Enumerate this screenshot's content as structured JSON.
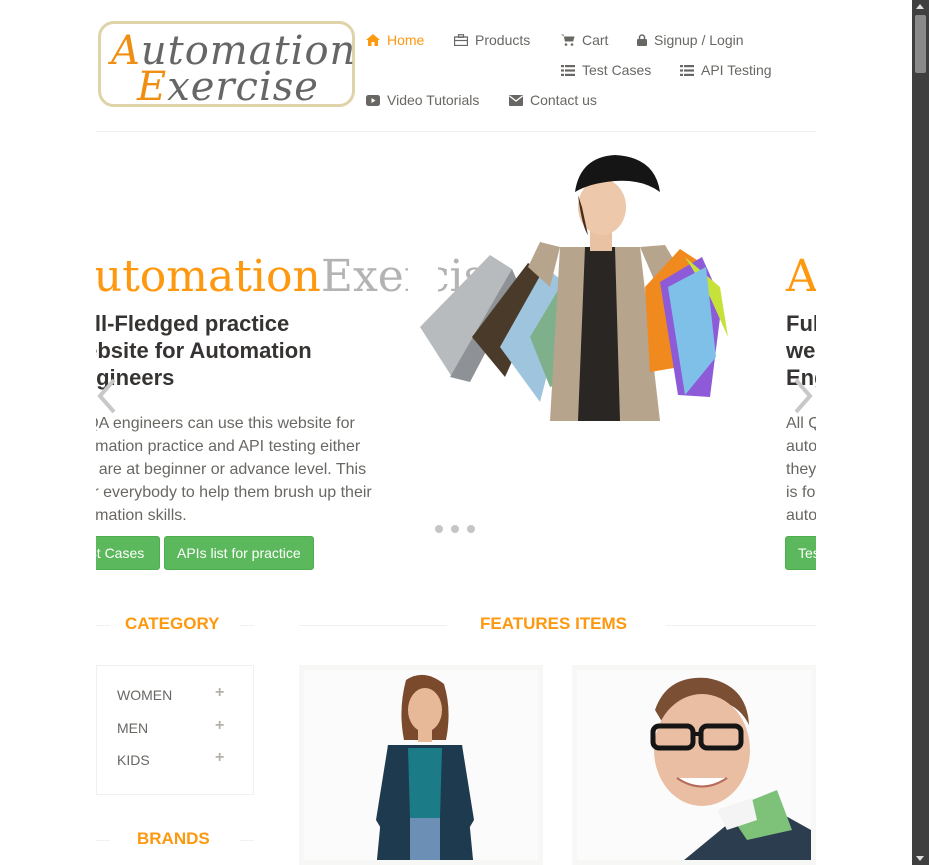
{
  "logo": {
    "line1_cap": "A",
    "line1_rest": "utomation",
    "line2_cap": "E",
    "line2_rest": "xercise"
  },
  "nav": {
    "home": "Home",
    "products": "Products",
    "cart": "Cart",
    "signup": "Signup / Login",
    "test_cases": "Test Cases",
    "api_testing": "API Testing",
    "video": "Video Tutorials",
    "contact": "Contact us"
  },
  "slider": {
    "title_a": "Automation",
    "title_b": "Exercise",
    "heading_lines": [
      "Full-Fledged practice",
      "website for Automation",
      "Engineers"
    ],
    "para_lines": [
      "All QA engineers can use this website for",
      "automation practice and API testing either",
      "they are at beginner or advance level. This",
      "is for everybody to help them brush up their",
      "automation skills."
    ],
    "btn_test_cases": "Test Cases",
    "btn_apis": "APIs list for practice"
  },
  "sections": {
    "category": "CATEGORY",
    "features": "FEATURES ITEMS",
    "brands": "BRANDS"
  },
  "categories": [
    "Women",
    "Men",
    "Kids"
  ],
  "colors": {
    "accent": "#fe980f",
    "button": "#5cb85c",
    "text": "#696763"
  }
}
